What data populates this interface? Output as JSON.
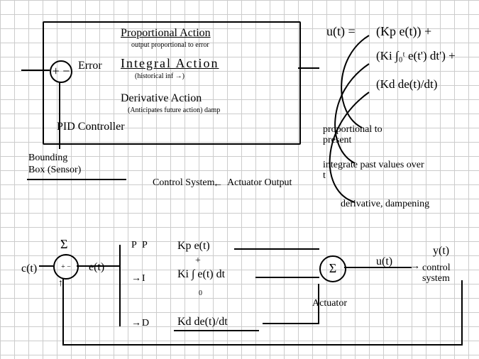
{
  "pid_box": {
    "error_label": "Error",
    "proportional": {
      "title": "Proportional Action",
      "note": "output proportional to error"
    },
    "integral": {
      "title": "Integral Action",
      "note": "(historical inf →)"
    },
    "derivative": {
      "title": "Derivative Action",
      "note": "(Anticipates future action) damp"
    },
    "controller_label": "PID Controller",
    "sum_symbol": "+ −"
  },
  "sensor": {
    "label1": "Bounding",
    "label2": "Box (Sensor)"
  },
  "control_system_arrow": {
    "left": "Control System",
    "right": "Actuator Output"
  },
  "equation": {
    "lhs": "u(t) =",
    "term_p": "(Kp e(t)) +",
    "term_i": "(Ki ∫₀ᵗ e(t') dt') +",
    "term_d": "(Kd de(t)/dt)"
  },
  "annotations": {
    "present": "proportional to present",
    "past": "integrate past values over t",
    "future": "derivative, dampening"
  },
  "lower_diagram": {
    "input": "c(t)",
    "sum_top": "Σ",
    "sum_sign": "+ −",
    "error": "e(t)",
    "branch_p": "P",
    "branch_i": "I",
    "branch_d": "D",
    "expr_p": "Kp e(t)",
    "expr_i": "Ki ∫ e(t) dt",
    "expr_i_lower": "0",
    "expr_d": "Kd de(t)/dt",
    "sum2": "Σ",
    "actuator": "Actuator",
    "u": "u(t)",
    "output_system": "control system",
    "y": "y(t)"
  },
  "chart_data": {
    "type": "diagram",
    "description": "Hand-drawn PID controller block diagram with equation u(t)=Kp e(t)+Ki ∫ e dt + Kd de/dt, upper box listing Proportional/Integral/Derivative actions, lower signal-flow: c(t)→Σ→e(t)→[P,I,D]→Σ→u(t)→control system→y(t) with feedback to first Σ via bounding-box sensor.",
    "blocks": [
      "Error",
      "Proportional Action",
      "Integral Action",
      "Derivative Action",
      "PID Controller",
      "Bounding Box (Sensor)",
      "Control System",
      "Actuator",
      "Σ"
    ],
    "signals": [
      "c(t)",
      "e(t)",
      "u(t)",
      "y(t)"
    ],
    "pid_terms": {
      "P": "Kp e(t)",
      "I": "Ki ∫₀ᵗ e(t') dt'",
      "D": "Kd de(t)/dt"
    }
  }
}
